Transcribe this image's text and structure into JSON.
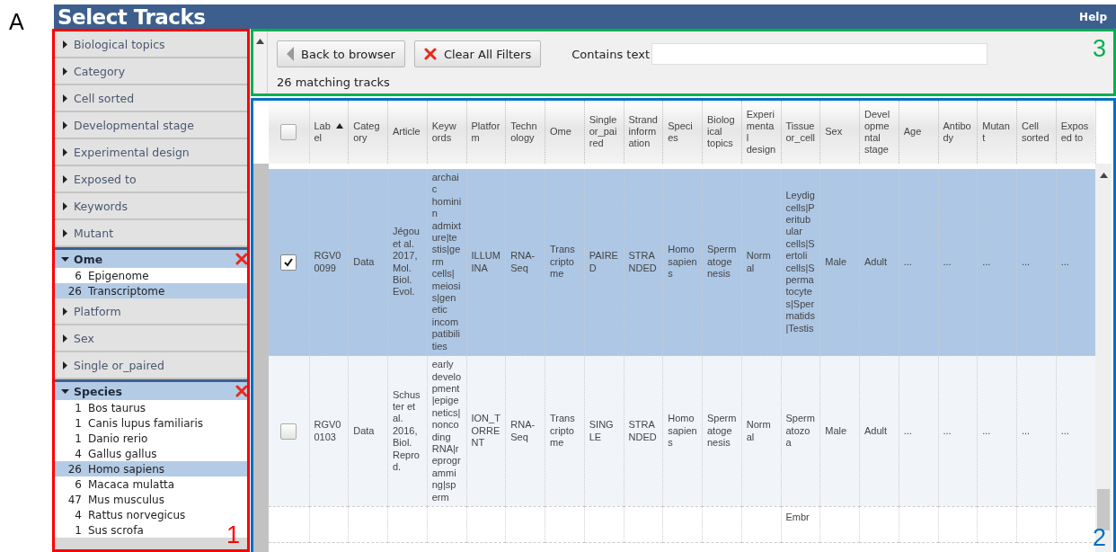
{
  "figure": {
    "panel_label": "A",
    "region_labels": [
      {
        "label": "1",
        "color": "#ff0000"
      },
      {
        "label": "2",
        "color": "#0070c0"
      },
      {
        "label": "3",
        "color": "#00b050"
      }
    ]
  },
  "window": {
    "title": "Select Tracks",
    "help": "Help"
  },
  "facets": [
    {
      "label": "Biological topics",
      "expanded": false
    },
    {
      "label": "Category",
      "expanded": false
    },
    {
      "label": "Cell sorted",
      "expanded": false
    },
    {
      "label": "Developmental stage",
      "expanded": false
    },
    {
      "label": "Experimental design",
      "expanded": false
    },
    {
      "label": "Exposed to",
      "expanded": false
    },
    {
      "label": "Keywords",
      "expanded": false
    },
    {
      "label": "Mutant",
      "expanded": false
    },
    {
      "label": "Ome",
      "expanded": true,
      "items": [
        {
          "count": "6",
          "label": "Epigenome",
          "selected": false
        },
        {
          "count": "26",
          "label": "Transcriptome",
          "selected": true
        }
      ]
    },
    {
      "label": "Platform",
      "expanded": false
    },
    {
      "label": "Sex",
      "expanded": false
    },
    {
      "label": "Single or_paired",
      "expanded": false
    },
    {
      "label": "Species",
      "expanded": true,
      "items": [
        {
          "count": "1",
          "label": "Bos taurus",
          "selected": false
        },
        {
          "count": "1",
          "label": "Canis lupus familiaris",
          "selected": false
        },
        {
          "count": "1",
          "label": "Danio rerio",
          "selected": false
        },
        {
          "count": "4",
          "label": "Gallus gallus",
          "selected": false
        },
        {
          "count": "26",
          "label": "Homo sapiens",
          "selected": true
        },
        {
          "count": "6",
          "label": "Macaca mulatta",
          "selected": false
        },
        {
          "count": "47",
          "label": "Mus musculus",
          "selected": false
        },
        {
          "count": "4",
          "label": "Rattus norvegicus",
          "selected": false
        },
        {
          "count": "1",
          "label": "Sus scrofa",
          "selected": false
        }
      ]
    }
  ],
  "toolbar": {
    "back_button": "Back to browser",
    "clear_button": "Clear All Filters",
    "search": {
      "label": "Contains text"
    },
    "match_count": "26 matching tracks"
  },
  "table": {
    "select_all_checked": false,
    "columns": [
      {
        "label": "Label",
        "sorted": true
      },
      {
        "label": "Category",
        "sorted": false
      },
      {
        "label": "Article",
        "sorted": false
      },
      {
        "label": "Keywords",
        "sorted": false
      },
      {
        "label": "Platform",
        "sorted": false
      },
      {
        "label": "Technology",
        "sorted": false
      },
      {
        "label": "Ome",
        "sorted": false
      },
      {
        "label": "Single or_paired",
        "sorted": false
      },
      {
        "label": "Strand information",
        "sorted": false
      },
      {
        "label": "Species",
        "sorted": false
      },
      {
        "label": "Biological topics",
        "sorted": false
      },
      {
        "label": "Experimental design",
        "sorted": false
      },
      {
        "label": "Tissue or_cell",
        "sorted": false
      },
      {
        "label": "Sex",
        "sorted": false
      },
      {
        "label": "Developmental stage",
        "sorted": false
      },
      {
        "label": "Age",
        "sorted": false
      },
      {
        "label": "Antibody",
        "sorted": false
      },
      {
        "label": "Mutant",
        "sorted": false
      },
      {
        "label": "Cell sorted",
        "sorted": false
      },
      {
        "label": "Exposed to",
        "sorted": false
      }
    ],
    "rows": [
      {
        "selected": true,
        "checked": true,
        "cells": [
          "RGV00099",
          "Data",
          "Jégou et al. 2017, Mol. Biol. Evol.",
          "archaic hominin admixture|testis|germ cells|meiosis|genetic incompatibilities",
          "ILLUMINA",
          "RNA-Seq",
          "Transcriptome",
          "PAIRED",
          "STRANDED",
          "Homo sapiens",
          "Spermatogenesis",
          "Normal",
          "Leydig cells|Peritubular cells|Sertoli cells|Spermatocytes|Spermatids|Testis",
          "Male",
          "Adult",
          "...",
          "...",
          "...",
          "...",
          "..."
        ]
      },
      {
        "selected": false,
        "checked": false,
        "cells": [
          "RGV00103",
          "Data",
          "Schuster et al. 2016, Biol. Reprod.",
          "early development|epigenetics|noncoding RNA|reprogramming|sperm",
          "ION_TORRENT",
          "RNA-Seq",
          "Transcriptome",
          "SINGLE",
          "STRANDED",
          "Homo sapiens",
          "Spermatogenesis",
          "Normal",
          "Spermatozoa",
          "Male",
          "Adult",
          "...",
          "...",
          "...",
          "...",
          "..."
        ]
      },
      {
        "selected": false,
        "cells": [
          null,
          null,
          null,
          null,
          null,
          null,
          null,
          null,
          null,
          null,
          null,
          null,
          "Embr",
          null,
          null,
          null,
          null,
          null,
          null,
          null
        ]
      }
    ]
  }
}
